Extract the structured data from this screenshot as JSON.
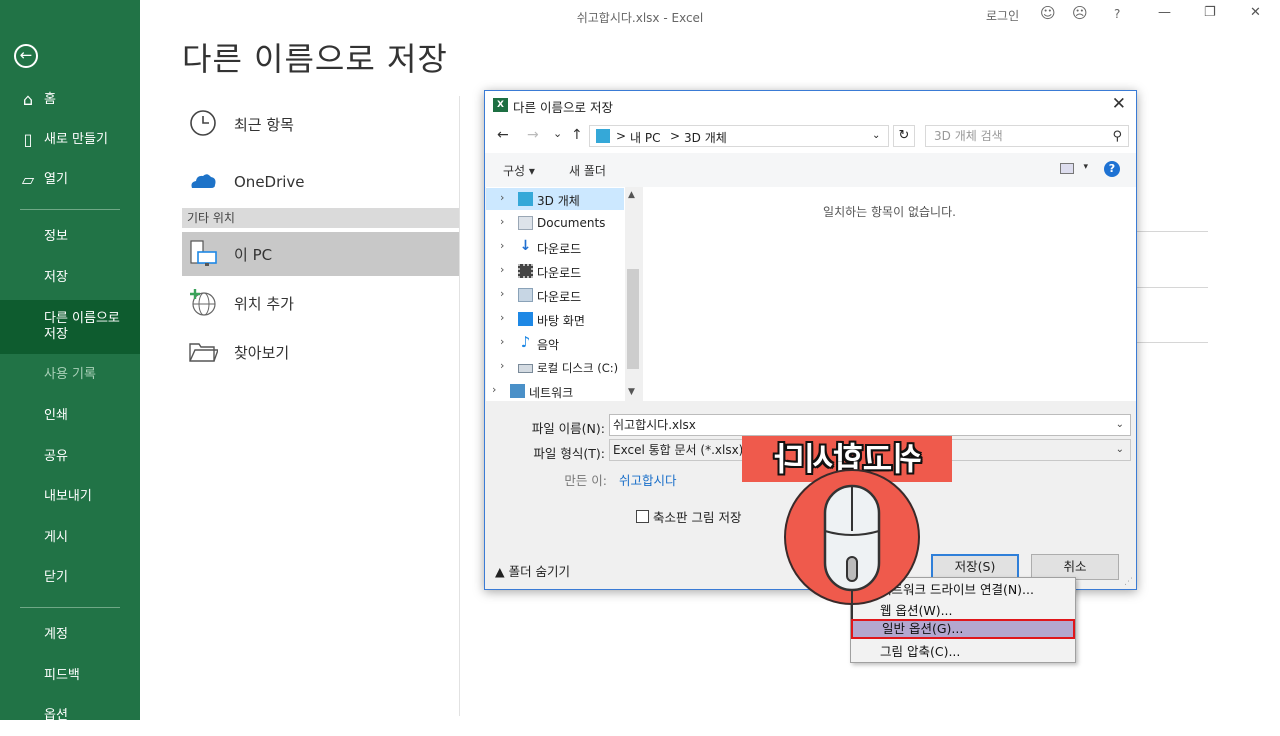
{
  "window": {
    "title": "쉬고합시다.xlsx  -  Excel",
    "user": "로그인",
    "smile": "☺",
    "frown": "☹",
    "help": "?",
    "minimize": "—",
    "restore": "❐",
    "close": "✕"
  },
  "sidebar": {
    "back": "←",
    "items": [
      {
        "label": "홈",
        "icon": "home-icon",
        "glyph": "⌂"
      },
      {
        "label": "새로 만들기",
        "icon": "new-doc-icon",
        "glyph": "▯"
      },
      {
        "label": "열기",
        "icon": "folder-open-icon",
        "glyph": "▱"
      },
      {
        "label": "정보"
      },
      {
        "label": "저장"
      },
      {
        "label": "다른 이름으로\n저장"
      },
      {
        "label": "사용 기록"
      },
      {
        "label": "인쇄"
      },
      {
        "label": "공유"
      },
      {
        "label": "내보내기"
      },
      {
        "label": "게시"
      },
      {
        "label": "닫기"
      },
      {
        "label": "계정"
      },
      {
        "label": "피드백"
      },
      {
        "label": "옵션"
      }
    ]
  },
  "page": {
    "title": "다른 이름으로 저장"
  },
  "locations": {
    "recent": "최근 항목",
    "onedrive": "OneDrive",
    "other_header": "기타 위치",
    "this_pc": "이 PC",
    "add_place": "위치 추가",
    "browse": "찾아보기"
  },
  "dialog": {
    "title": "다른 이름으로 저장",
    "xl_badge": "X",
    "close": "✕",
    "nav": {
      "back": "←",
      "forward": "→",
      "recent": "⌄",
      "up": "↑"
    },
    "path": [
      "내 PC",
      "3D 개체"
    ],
    "path_sep": ">",
    "refresh": "↻",
    "search_placeholder": "3D 개체 검색",
    "search_icon": "⚲",
    "toolbar": {
      "organize": "구성 ▾",
      "new_folder": "새 폴더",
      "view_caret": "▾",
      "help": "?"
    },
    "tree": [
      {
        "label": "3D 개체",
        "icon": "3d-objects-icon",
        "color": "#35a8d8",
        "selected": true
      },
      {
        "label": "Documents",
        "icon": "documents-icon",
        "color": "#9aa7b5"
      },
      {
        "label": "다운로드",
        "icon": "download-icon",
        "color": "#1f6fd1"
      },
      {
        "label": "다운로드",
        "icon": "video-icon",
        "color": "#444444"
      },
      {
        "label": "다운로드",
        "icon": "pictures-icon",
        "color": "#8aa2b8"
      },
      {
        "label": "바탕 화면",
        "icon": "desktop-icon",
        "color": "#1e88e5"
      },
      {
        "label": "음악",
        "icon": "music-icon",
        "color": "#1e88e5"
      },
      {
        "label": "로컬 디스크 (C:)",
        "icon": "drive-icon",
        "color": "#7a8a99"
      },
      {
        "label": "네트워크",
        "icon": "network-icon",
        "color": "#4a90c8"
      }
    ],
    "tree_chevron": "›",
    "empty_message": "일치하는 항목이 없습니다.",
    "filename_label": "파일 이름(N):",
    "filename_value": "쉬고합시다.xlsx",
    "filetype_label": "파일 형식(T):",
    "filetype_value": "Excel 통합 문서 (*.xlsx)",
    "author_label": "만든 이:",
    "author_value": "쉬고합시다",
    "thumbnail_label": "축소판 그림 저장",
    "hide_folders": "▲ 폴더 숨기기",
    "save_button": "저장(S)",
    "cancel_button": "취소"
  },
  "overlay": {
    "banner_text": "쉬고합시다",
    "banner_color": "#ef5a4c"
  },
  "context_menu": {
    "items": [
      {
        "label": "네트워크 드라이브 연결(N)...",
        "highlighted": false
      },
      {
        "label": "웹 옵션(W)...",
        "highlighted": false
      },
      {
        "label": "일반 옵션(G)...",
        "highlighted": true
      },
      {
        "label": "그림 압축(C)...",
        "highlighted": false
      }
    ]
  }
}
